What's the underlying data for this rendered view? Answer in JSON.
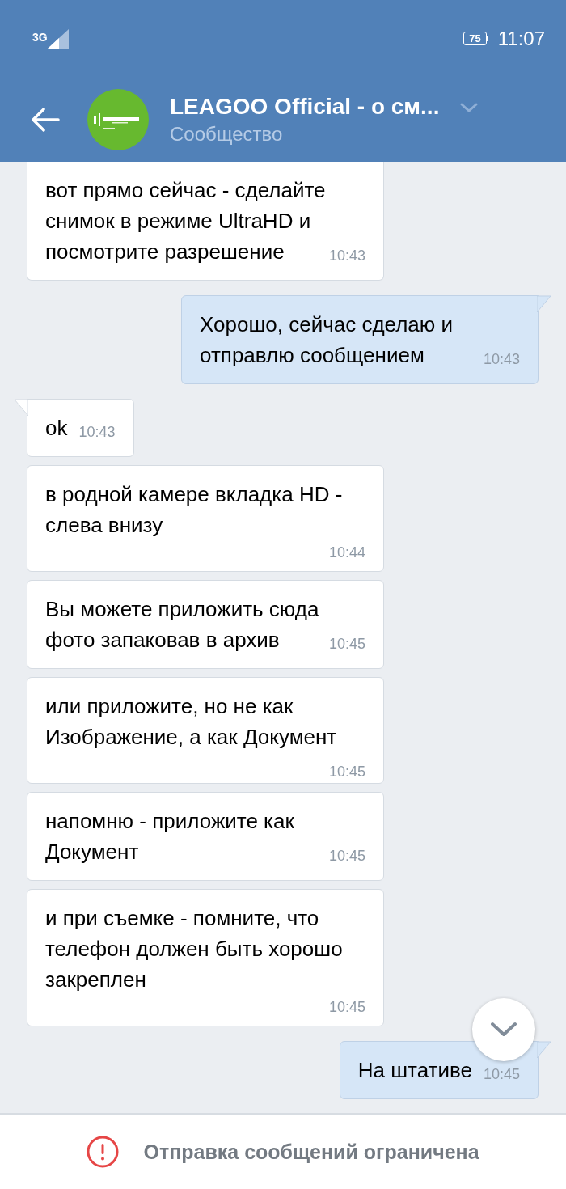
{
  "status_bar": {
    "network": "3G",
    "battery": "75",
    "time": "11:07"
  },
  "header": {
    "title": "LEAGOO Official - о см...",
    "subtitle": "Сообщество"
  },
  "messages": [
    {
      "kind": "in",
      "tail": false,
      "text": "вот прямо сейчас - сделайте снимок в режиме UltraHD и посмотрите разрешение",
      "time": "10:43"
    },
    {
      "kind": "out",
      "tail": true,
      "text": "Хорошо, сейчас сделаю и отправлю сообщением",
      "time": "10:43"
    },
    {
      "kind": "in",
      "tail": true,
      "text": "ok",
      "time": "10:43"
    },
    {
      "kind": "in",
      "tail": false,
      "text": "в родной камере вкладка HD - слева внизу",
      "time": "10:44"
    },
    {
      "kind": "in",
      "tail": false,
      "text": "Вы можете приложить сюда фото запаковав в архив",
      "time": "10:45"
    },
    {
      "kind": "in",
      "tail": false,
      "text": "или приложите, но не как Изображение, а как Документ",
      "time": "10:45"
    },
    {
      "kind": "in",
      "tail": false,
      "text": "напомню - приложите как Документ",
      "time": "10:45"
    },
    {
      "kind": "in",
      "tail": false,
      "text": "и при съемке - помните, что телефон должен быть хорошо закреплен",
      "time": "10:45"
    },
    {
      "kind": "out",
      "tail": true,
      "text": "На штативе",
      "time": "10:45"
    }
  ],
  "notice": "Отправка сообщений ограничена"
}
